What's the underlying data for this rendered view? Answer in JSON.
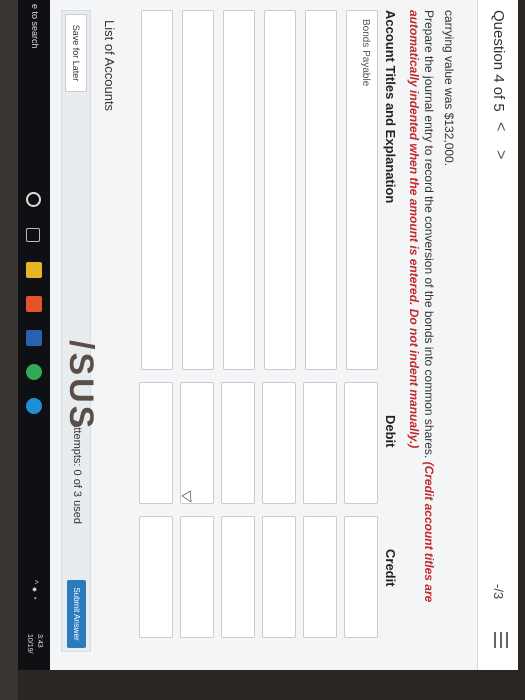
{
  "header": {
    "question_label": "Question 4 of 5",
    "prev_glyph": "<",
    "next_glyph": ">",
    "score": "-/3"
  },
  "content": {
    "context_text": "carrying value was $132,000.",
    "instruction": "Prepare the journal entry to record the conversion of the bonds into common shares.",
    "instruction_note": "(Credit account titles are automatically indented when the amount is entered. Do not indent manually.)"
  },
  "table": {
    "columns": [
      "Account Titles and Explanation",
      "Debit",
      "Credit"
    ],
    "rows": [
      {
        "account": "Bonds Payable",
        "debit": "",
        "credit": ""
      },
      {
        "account": "",
        "debit": "",
        "credit": ""
      },
      {
        "account": "",
        "debit": "",
        "credit": ""
      },
      {
        "account": "",
        "debit": "",
        "credit": ""
      },
      {
        "account": "",
        "debit": "",
        "credit": ""
      },
      {
        "account": "",
        "debit": "",
        "credit": ""
      }
    ]
  },
  "footer": {
    "list_of_accounts": "List of Accounts",
    "save_label": "Save for Later",
    "attempts": "Attempts: 0 of 3 used",
    "submit_label": "Submit Answer"
  },
  "taskbar": {
    "search_text": "e to search",
    "time": "3:43",
    "date": "10/19/"
  },
  "laptop_brand": "/SUS",
  "colors": {
    "accent": "#2b7bbf",
    "warning_text": "#c0282b",
    "taskbar": "#0f1013"
  }
}
